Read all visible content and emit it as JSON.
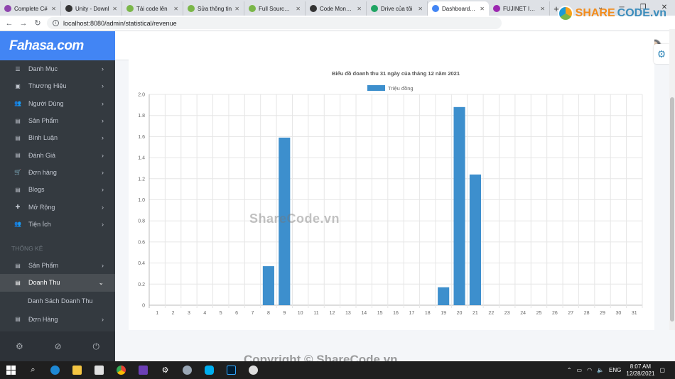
{
  "browser": {
    "tabs": [
      {
        "label": "Complete C#",
        "color": "#8e44ad"
      },
      {
        "label": "Unity - Downl",
        "color": "#333333"
      },
      {
        "label": "Tải code lên",
        "color": "#7ab648"
      },
      {
        "label": "Sửa thông tin",
        "color": "#7ab648"
      },
      {
        "label": "Full Source Co",
        "color": "#7ab648"
      },
      {
        "label": "Code Monkey",
        "color": "#333333"
      },
      {
        "label": "Drive của tôi",
        "color": "#1fa463"
      },
      {
        "label": "Dashboard Ed",
        "color": "#4285f4",
        "active": true
      },
      {
        "label": "FUJINET IT RE",
        "color": "#9c27b0"
      }
    ],
    "new_tab": "+",
    "url": "localhost:8080/admin/statistical/revenue"
  },
  "sharecode_logo": {
    "part1": "SHARE",
    "part2": "CODE.vn"
  },
  "sidebar": {
    "brand": "Fahasa.com",
    "items": [
      {
        "label": "Danh Mục",
        "icon": "list-icon",
        "glyph": "☰"
      },
      {
        "label": "Thương Hiệu",
        "icon": "chip-icon",
        "glyph": "▣"
      },
      {
        "label": "Người Dùng",
        "icon": "users-icon",
        "glyph": "👥"
      },
      {
        "label": "Sản Phẩm",
        "icon": "product-icon",
        "glyph": "▤"
      },
      {
        "label": "Bình Luận",
        "icon": "comment-icon",
        "glyph": "▤"
      },
      {
        "label": "Đánh Giá",
        "icon": "review-icon",
        "glyph": "▤"
      },
      {
        "label": "Đơn hàng",
        "icon": "cart-icon",
        "glyph": "🛒"
      },
      {
        "label": "Blogs",
        "icon": "blog-icon",
        "glyph": "▤"
      },
      {
        "label": "Mở Rộng",
        "icon": "puzzle-icon",
        "glyph": "✚"
      },
      {
        "label": "Tiện Ích",
        "icon": "utilities-icon",
        "glyph": "👥"
      }
    ],
    "section_header": "THỐNG KÊ",
    "stats_items": [
      {
        "label": "Sản Phẩm",
        "icon": "product-stat-icon",
        "glyph": "▤"
      },
      {
        "label": "Doanh Thu",
        "icon": "revenue-icon",
        "glyph": "▤",
        "active": true
      }
    ],
    "sub_item": "Danh Sách Doanh Thu",
    "last_item": {
      "label": "Đơn Hàng",
      "icon": "order-stat-icon",
      "glyph": "▤"
    }
  },
  "watermark": "ShareCode.vn",
  "copyright": "Copyright © ShareCode.vn",
  "taskbar": {
    "lang": "ENG",
    "time": "8:07 AM",
    "date": "12/28/2021"
  },
  "chart_data": {
    "type": "bar",
    "title": "Biểu đồ doanh thu 31 ngày của tháng 12 năm 2021",
    "legend": "Triệu đồng",
    "legend_position": "top",
    "bar_color": "#3d8fcd",
    "grid": true,
    "ylim": [
      0,
      2.0
    ],
    "yticks": [
      "0",
      "0.2",
      "0.4",
      "0.6",
      "0.8",
      "1.0",
      "1.2",
      "1.4",
      "1.6",
      "1.8",
      "2.0"
    ],
    "categories": [
      "1",
      "2",
      "3",
      "4",
      "5",
      "6",
      "7",
      "8",
      "9",
      "10",
      "11",
      "12",
      "13",
      "14",
      "15",
      "16",
      "17",
      "18",
      "19",
      "20",
      "21",
      "22",
      "23",
      "24",
      "25",
      "26",
      "27",
      "28",
      "29",
      "30",
      "31"
    ],
    "series": [
      {
        "name": "Triệu đồng",
        "values": [
          0,
          0,
          0,
          0,
          0,
          0,
          0,
          0.37,
          1.59,
          0,
          0,
          0,
          0,
          0,
          0,
          0,
          0,
          0,
          0.17,
          1.88,
          1.24,
          0,
          0,
          0,
          0,
          0,
          0,
          0,
          0,
          0,
          0
        ]
      }
    ]
  }
}
